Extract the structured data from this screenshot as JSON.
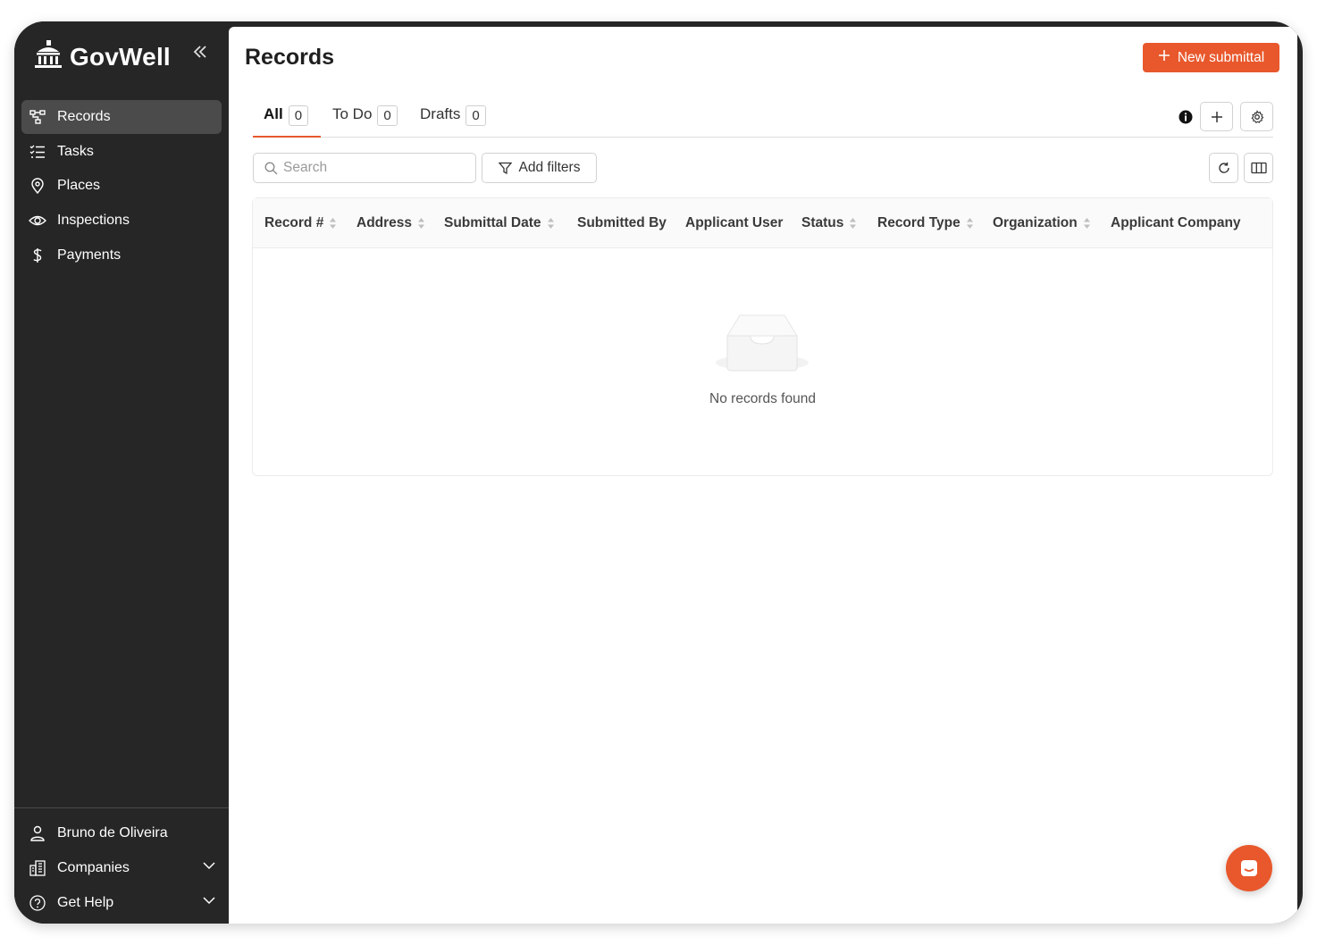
{
  "app": {
    "name": "GovWell",
    "collapse_icon": "chevron-double-left-icon"
  },
  "sidebar": {
    "items": [
      {
        "label": "Records",
        "icon": "records-icon",
        "active": true
      },
      {
        "label": "Tasks",
        "icon": "tasks-icon",
        "active": false
      },
      {
        "label": "Places",
        "icon": "location-pin-icon",
        "active": false
      },
      {
        "label": "Inspections",
        "icon": "eye-icon",
        "active": false
      },
      {
        "label": "Payments",
        "icon": "dollar-icon",
        "active": false
      }
    ],
    "bottom": [
      {
        "label": "Bruno de Oliveira",
        "icon": "user-icon"
      },
      {
        "label": "Companies",
        "icon": "building-icon"
      },
      {
        "label": "Get Help",
        "icon": "help-circle-icon"
      }
    ]
  },
  "main": {
    "title": "Records",
    "new_button": "New submittal",
    "tabs": [
      {
        "label": "All",
        "count": "0",
        "active": true
      },
      {
        "label": "To Do",
        "count": "0",
        "active": false
      },
      {
        "label": "Drafts",
        "count": "0",
        "active": false
      }
    ],
    "search": {
      "placeholder": "Search"
    },
    "filter_button": "Add filters",
    "columns": [
      {
        "label": "Record #",
        "sortable": true
      },
      {
        "label": "Address",
        "sortable": true
      },
      {
        "label": "Submittal Date",
        "sortable": true
      },
      {
        "label": "Submitted By",
        "sortable": false
      },
      {
        "label": "Applicant User",
        "sortable": false
      },
      {
        "label": "Status",
        "sortable": true
      },
      {
        "label": "Record Type",
        "sortable": true
      },
      {
        "label": "Organization",
        "sortable": true
      },
      {
        "label": "Applicant Company",
        "sortable": false
      }
    ],
    "empty_text": "No records found"
  },
  "colors": {
    "accent": "#e8582c",
    "sidebar_bg": "#262626",
    "active_item_bg": "#4b4b4b"
  }
}
